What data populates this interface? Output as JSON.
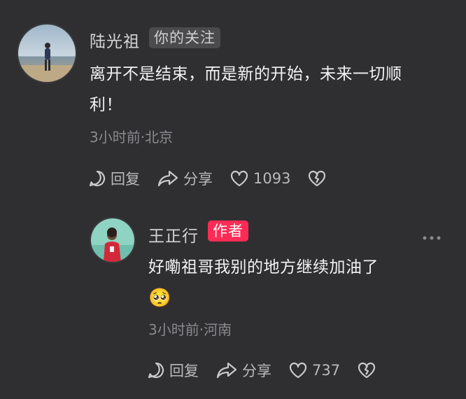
{
  "comments": [
    {
      "author": "陆光祖",
      "tag": "你的关注",
      "text_line1": "离开不是结束，而是新的开始，未来一切顺",
      "text_line2": "利！",
      "meta": "3小时前·北京",
      "actions": {
        "reply": "回复",
        "share": "分享",
        "likes": "1093"
      }
    },
    {
      "author": "王正行",
      "tag": "作者",
      "text_line1": "好嘞祖哥我别的地方继续加油了",
      "emoji": "🥺",
      "meta": "3小时前·河南",
      "actions": {
        "reply": "回复",
        "share": "分享",
        "likes": "737"
      }
    }
  ],
  "colors": {
    "background": "#2f2f31",
    "author_tag": "#fe2c55"
  }
}
